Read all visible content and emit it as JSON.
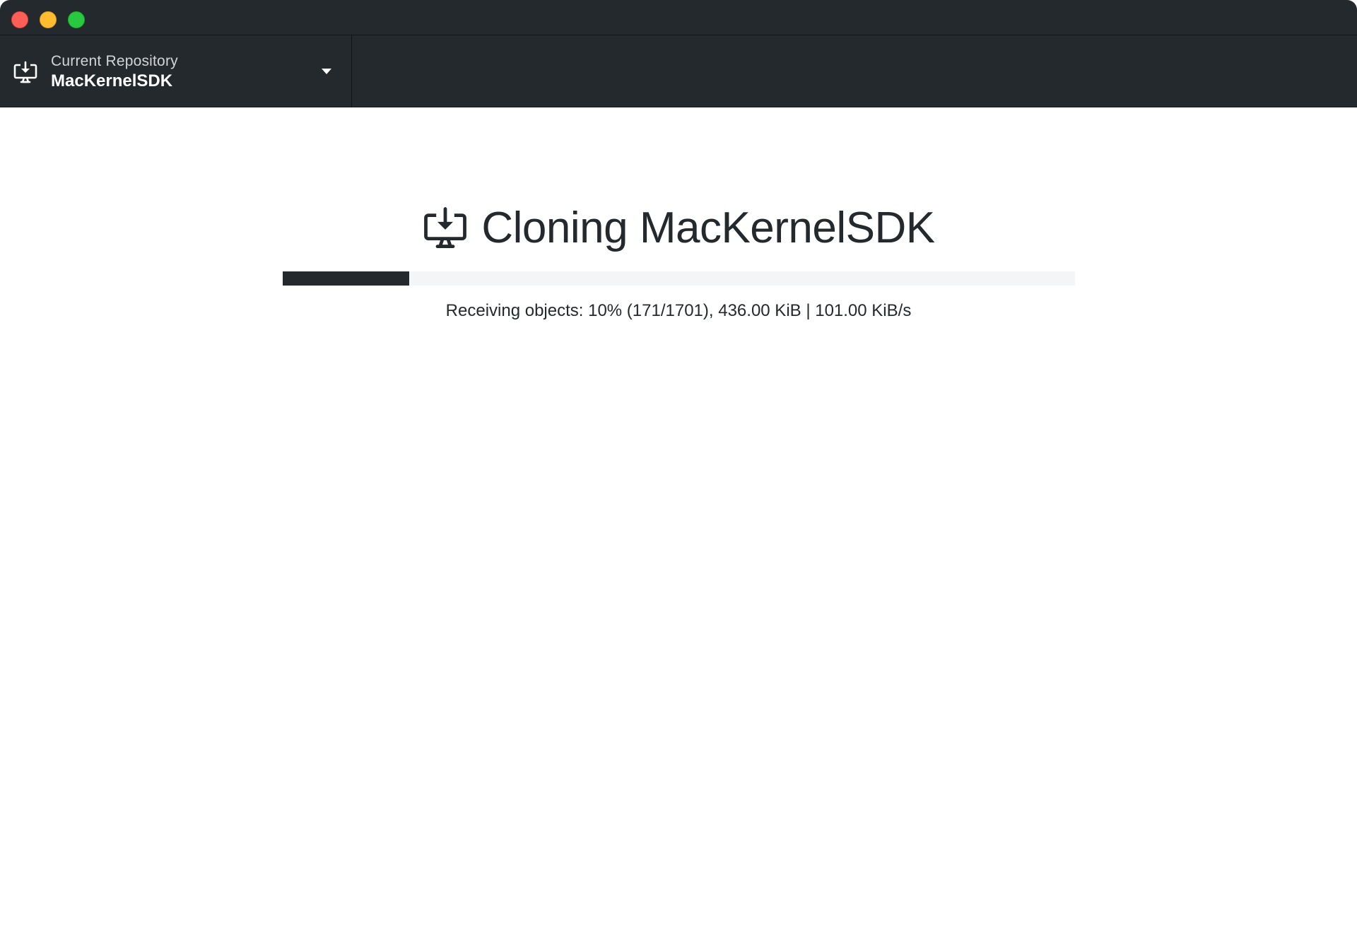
{
  "toolbar": {
    "repo_label": "Current Repository",
    "repo_name": "MacKernelSDK",
    "repo_icon": "desktop-download-icon",
    "dropdown_icon": "caret-down-icon"
  },
  "clone": {
    "title": "Cloning MacKernelSDK",
    "icon": "desktop-download-icon",
    "progress_fraction": 0.16,
    "status_text": "Receiving objects: 10% (171/1701), 436.00 KiB | 101.00 KiB/s"
  },
  "colors": {
    "titlebar_bg": "#24292e",
    "progress_fill": "#24292e",
    "progress_track": "#f3f5f7",
    "close": "#ff5f57",
    "minimize": "#febc2e",
    "maximize": "#28c840"
  }
}
